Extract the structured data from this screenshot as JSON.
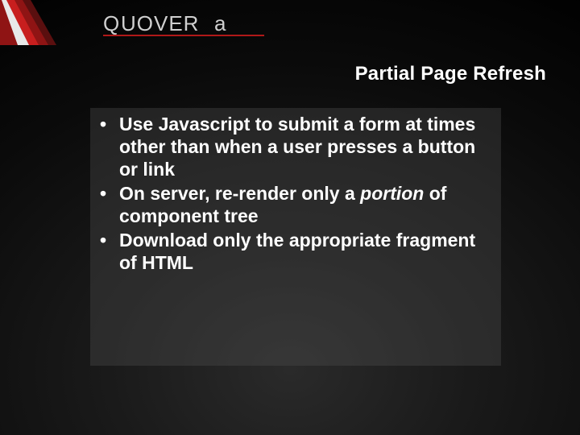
{
  "brand": {
    "name": "QUOVERA"
  },
  "slide": {
    "title": "Partial Page Refresh",
    "bullets": [
      {
        "pre": "Use Javascript to submit a form at times other than when a user presses a button or link",
        "em": "",
        "post": ""
      },
      {
        "pre": "On server, re-render only a ",
        "em": "portion",
        "post": " of component tree"
      },
      {
        "pre": "Download only the appropriate fragment of HTML",
        "em": "",
        "post": ""
      }
    ]
  }
}
